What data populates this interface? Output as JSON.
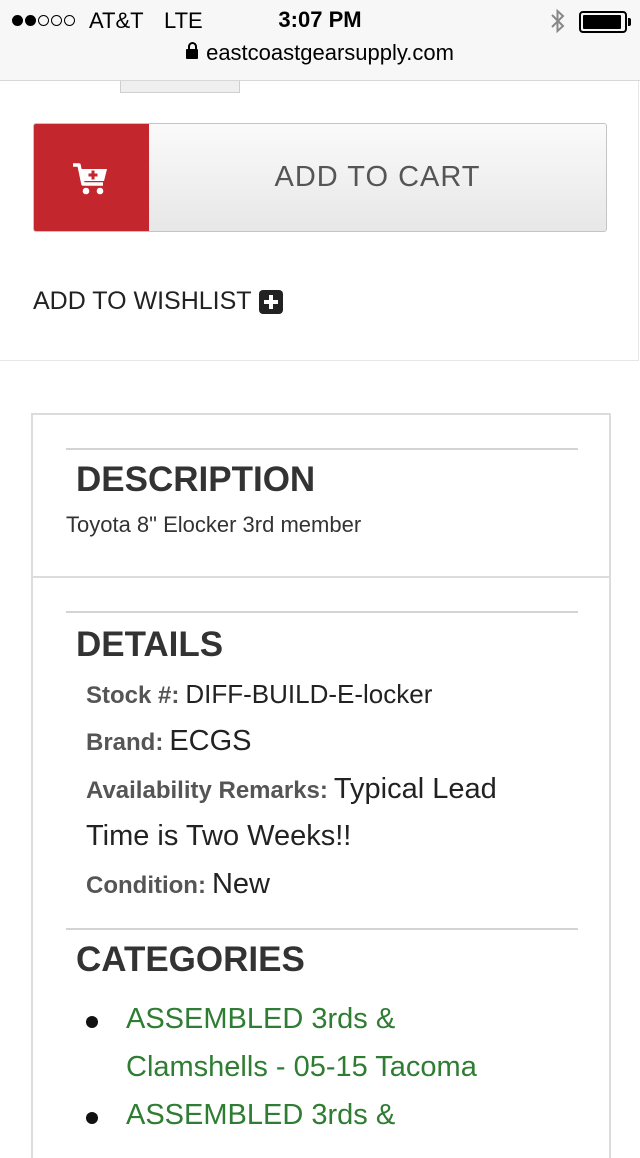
{
  "status_bar": {
    "carrier": "AT&T",
    "network": "LTE",
    "time": "3:07 PM",
    "url": "eastcoastgearsupply.com"
  },
  "product_actions": {
    "add_to_cart_label": "ADD TO CART",
    "add_to_wishlist_label": "ADD TO WISHLIST",
    "cart_icon": "cart-plus-icon",
    "accent_color": "#c4262e"
  },
  "description": {
    "heading": "DESCRIPTION",
    "text": "Toyota 8\" Elocker 3rd member"
  },
  "details": {
    "heading": "DETAILS",
    "stock_label": "Stock #:",
    "stock_value": "DIFF-BUILD-E-locker",
    "brand_label": "Brand:",
    "brand_value": "ECGS",
    "availability_label": "Availability Remarks:",
    "availability_value_line1": "Typical Lead",
    "availability_value_line2": "Time is Two Weeks!!",
    "condition_label": "Condition:",
    "condition_value": "New"
  },
  "categories": {
    "heading": "CATEGORIES",
    "items": [
      "ASSEMBLED 3rds & Clamshells - 05-15 Tacoma",
      "ASSEMBLED 3rds &"
    ],
    "link_color": "#2e7d32"
  }
}
